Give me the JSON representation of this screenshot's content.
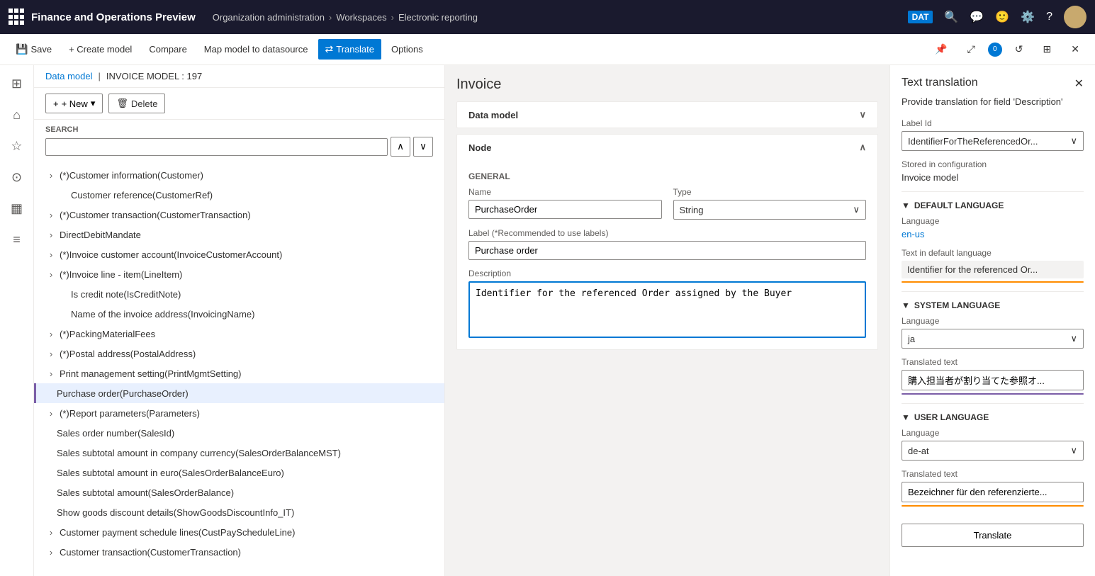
{
  "app": {
    "title": "Finance and Operations Preview",
    "grid_icon": "app-grid-icon"
  },
  "breadcrumb": {
    "items": [
      "Organization administration",
      "Workspaces",
      "Electronic reporting"
    ]
  },
  "nav": {
    "dat_label": "DAT"
  },
  "toolbar": {
    "save_label": "Save",
    "create_model_label": "+ Create model",
    "compare_label": "Compare",
    "map_model_label": "Map model to datasource",
    "translate_label": "Translate",
    "options_label": "Options"
  },
  "breadcrumb_bar": {
    "data_model": "Data model",
    "separator": "|",
    "model_name": "INVOICE MODEL : 197"
  },
  "tree": {
    "new_label": "+ New",
    "delete_label": "Delete",
    "search_label": "SEARCH",
    "search_placeholder": "",
    "items": [
      {
        "id": 1,
        "text": "(*)Customer information(Customer)",
        "indent": 0,
        "expandable": true
      },
      {
        "id": 2,
        "text": "Customer reference(CustomerRef)",
        "indent": 1,
        "expandable": false
      },
      {
        "id": 3,
        "text": "(*)Customer transaction(CustomerTransaction)",
        "indent": 0,
        "expandable": true
      },
      {
        "id": 4,
        "text": "DirectDebitMandate",
        "indent": 0,
        "expandable": true
      },
      {
        "id": 5,
        "text": "(*)Invoice customer account(InvoiceCustomerAccount)",
        "indent": 0,
        "expandable": true
      },
      {
        "id": 6,
        "text": "(*)Invoice line - item(LineItem)",
        "indent": 0,
        "expandable": true
      },
      {
        "id": 7,
        "text": "Is credit note(IsCreditNote)",
        "indent": 1,
        "expandable": false
      },
      {
        "id": 8,
        "text": "Name of the invoice address(InvoicingName)",
        "indent": 1,
        "expandable": false
      },
      {
        "id": 9,
        "text": "(*)PackingMaterialFees",
        "indent": 0,
        "expandable": true
      },
      {
        "id": 10,
        "text": "(*)Postal address(PostalAddress)",
        "indent": 0,
        "expandable": true
      },
      {
        "id": 11,
        "text": "Print management setting(PrintMgmtSetting)",
        "indent": 0,
        "expandable": true
      },
      {
        "id": 12,
        "text": "Purchase order(PurchaseOrder)",
        "indent": 0,
        "expandable": false,
        "selected": true
      },
      {
        "id": 13,
        "text": "(*)Report parameters(Parameters)",
        "indent": 0,
        "expandable": true
      },
      {
        "id": 14,
        "text": "Sales order number(SalesId)",
        "indent": 0,
        "expandable": false
      },
      {
        "id": 15,
        "text": "Sales subtotal amount in company currency(SalesOrderBalanceMST)",
        "indent": 0,
        "expandable": false
      },
      {
        "id": 16,
        "text": "Sales subtotal amount in euro(SalesOrderBalanceEuro)",
        "indent": 0,
        "expandable": false
      },
      {
        "id": 17,
        "text": "Sales subtotal amount(SalesOrderBalance)",
        "indent": 0,
        "expandable": false
      },
      {
        "id": 18,
        "text": "Show goods discount details(ShowGoodsDiscountInfo_IT)",
        "indent": 0,
        "expandable": false
      },
      {
        "id": 19,
        "text": "Customer payment schedule lines(CustPayScheduleLine)",
        "indent": 0,
        "expandable": true
      },
      {
        "id": 20,
        "text": "Customer transaction(CustomerTransaction)",
        "indent": 0,
        "expandable": true
      }
    ]
  },
  "main": {
    "title": "Invoice",
    "data_model_section": "Data model",
    "node_section": "Node",
    "general_label": "GENERAL",
    "type_label": "Type",
    "type_value": "String",
    "name_label": "Name",
    "name_value": "PurchaseOrder",
    "label_field_label": "Label (*Recommended to use labels)",
    "label_field_value": "Purchase order",
    "description_label": "Description",
    "description_value": "Identifier for the referenced Order assigned by the Buyer"
  },
  "right_panel": {
    "title": "Text translation",
    "subtitle": "Provide translation for field 'Description'",
    "label_id_label": "Label Id",
    "label_id_value": "IdentifierForTheReferencedOr...",
    "stored_in_label": "Stored in configuration",
    "stored_in_value": "Invoice model",
    "default_language_header": "DEFAULT LANGUAGE",
    "language_label": "Language",
    "default_lang_value": "en-us",
    "text_default_label": "Text in default language",
    "text_default_value": "Identifier for the referenced Or...",
    "system_language_header": "SYSTEM LANGUAGE",
    "system_lang_label": "Language",
    "system_lang_value": "ja",
    "translated_text_label": "Translated text",
    "system_translated_value": "購入担当者が割り当てた参照オ...",
    "user_language_header": "USER LANGUAGE",
    "user_lang_label": "Language",
    "user_lang_value": "de-at",
    "user_translated_label": "Translated text",
    "user_translated_value": "Bezeichner für den referenzierte...",
    "translate_btn_label": "Translate"
  }
}
